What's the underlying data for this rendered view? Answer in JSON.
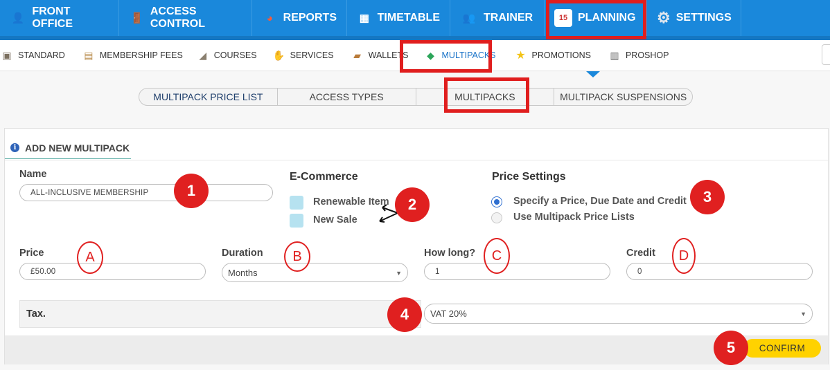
{
  "topnav": {
    "items": [
      {
        "label": "FRONT OFFICE",
        "icon": "person-icon",
        "glyph": "👤"
      },
      {
        "label": "ACCESS CONTROL",
        "icon": "door-icon",
        "glyph": "🚪"
      },
      {
        "label": "REPORTS",
        "icon": "pie-chart-icon",
        "glyph": "◕"
      },
      {
        "label": "TIMETABLE",
        "icon": "calendar-grid-icon",
        "glyph": "▦"
      },
      {
        "label": "TRAINER",
        "icon": "trainers-icon",
        "glyph": "👥"
      },
      {
        "label": "PLANNING",
        "icon": "calendar-icon",
        "glyph": "15"
      },
      {
        "label": "SETTINGS",
        "icon": "gear-icon",
        "glyph": "⚙"
      }
    ]
  },
  "subnav": {
    "items": [
      {
        "label": "STANDARD",
        "icon": "box-icon",
        "glyph": "▣"
      },
      {
        "label": "MEMBERSHIP FEES",
        "icon": "clipboard-icon",
        "glyph": "▤"
      },
      {
        "label": "COURSES",
        "icon": "shoe-icon",
        "glyph": "◢"
      },
      {
        "label": "SERVICES",
        "icon": "handshake-icon",
        "glyph": "✋"
      },
      {
        "label": "WALLETS",
        "icon": "wallet-icon",
        "glyph": "▰"
      },
      {
        "label": "MULTIPACKS",
        "icon": "blocks-icon",
        "glyph": "◆"
      },
      {
        "label": "PROMOTIONS",
        "icon": "star-icon",
        "glyph": "★"
      },
      {
        "label": "PROSHOP",
        "icon": "register-icon",
        "glyph": "▥"
      }
    ]
  },
  "tabs": [
    "MULTIPACK PRICE LIST",
    "ACCESS TYPES",
    "MULTIPACKS",
    "MULTIPACK SUSPENSIONS"
  ],
  "panel": {
    "title": "ADD NEW MULTIPACK",
    "name_label": "Name",
    "name_value": "ALL-INCLUSIVE MEMBERSHIP",
    "ecommerce_title": "E-Commerce",
    "ecommerce_options": [
      "Renewable Item",
      "New Sale"
    ],
    "price_settings_title": "Price Settings",
    "price_options": [
      "Specify a Price, Due Date and Credit",
      "Use Multipack Price Lists"
    ],
    "price_label": "Price",
    "price_value": "£50.00",
    "duration_label": "Duration",
    "duration_value": "Months",
    "how_long_label": "How long?",
    "how_long_value": "1",
    "credit_label": "Credit",
    "credit_value": "0",
    "tax_label": "Tax.",
    "tax_value": "VAT 20%",
    "confirm_label": "CONFIRM"
  },
  "annotations": {
    "badges": [
      "1",
      "2",
      "3",
      "4",
      "5"
    ],
    "rings": [
      "A",
      "B",
      "C",
      "D"
    ]
  },
  "colors": {
    "topnav": "#1a88db",
    "highlight": "#e01e1e",
    "confirm": "#ffd200",
    "checkbox": "#b6e2f0",
    "radio_selected": "#2f6fd0"
  }
}
